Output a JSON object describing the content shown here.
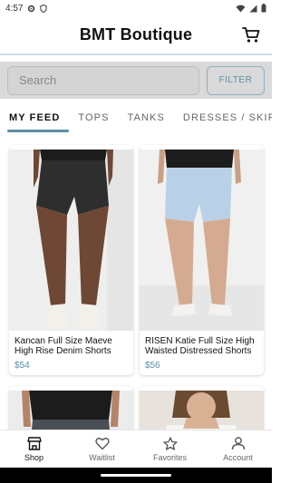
{
  "status_bar": {
    "time": "4:57"
  },
  "header": {
    "title": "BMT Boutique"
  },
  "search": {
    "placeholder": "Search",
    "filter_label": "FILTER"
  },
  "tabs": [
    {
      "label": "MY FEED"
    },
    {
      "label": "TOPS"
    },
    {
      "label": "TANKS"
    },
    {
      "label": "DRESSES / SKIRTS"
    }
  ],
  "products": [
    {
      "name": "Kancan Full Size Maeve High Rise Denim Shorts",
      "price": "$54"
    },
    {
      "name": "RISEN Katie Full Size High Waisted Distressed Shorts",
      "price": "$56"
    }
  ],
  "bottom_nav": [
    {
      "label": "Shop"
    },
    {
      "label": "Waitlist"
    },
    {
      "label": "Favorites"
    },
    {
      "label": "Account"
    }
  ],
  "colors": {
    "accent": "#5d8ea3",
    "search_band": "#d9d9d9",
    "header_rule": "#cfdde4"
  }
}
